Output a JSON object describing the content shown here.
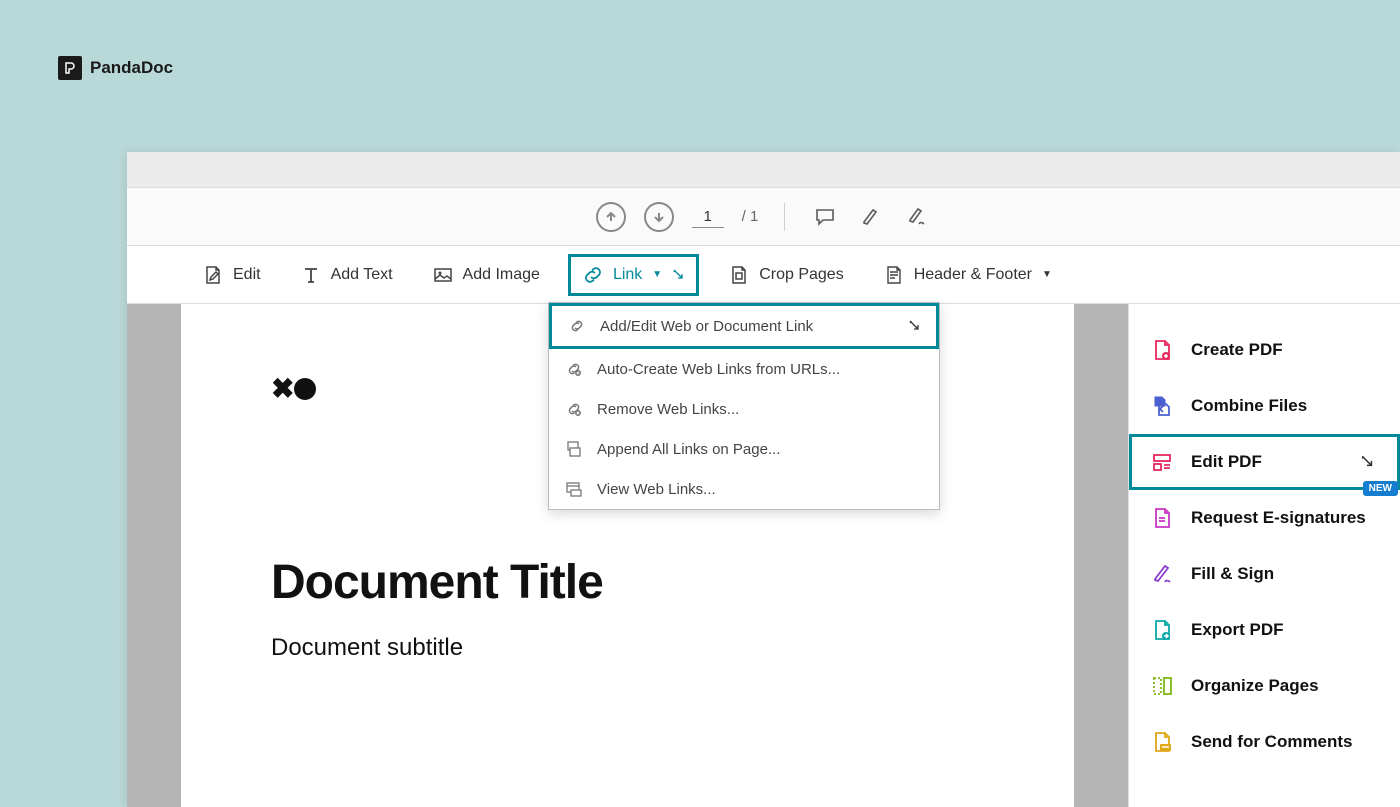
{
  "brand": {
    "name": "PandaDoc"
  },
  "pagebar": {
    "current": "1",
    "total": "/ 1"
  },
  "toolbar": {
    "edit": "Edit",
    "addText": "Add Text",
    "addImage": "Add Image",
    "link": "Link",
    "cropPages": "Crop Pages",
    "headerFooter": "Header & Footer"
  },
  "linkMenu": {
    "items": [
      "Add/Edit Web or Document Link",
      "Auto-Create Web Links from URLs...",
      "Remove Web Links...",
      "Append All Links on Page...",
      "View Web Links..."
    ]
  },
  "document": {
    "title": "Document Title",
    "subtitle": "Document subtitle"
  },
  "sidebar": {
    "createPdf": "Create PDF",
    "combineFiles": "Combine Files",
    "editPdf": "Edit PDF",
    "requestSig": "Request E-signatures",
    "fillSign": "Fill & Sign",
    "exportPdf": "Export PDF",
    "organizePages": "Organize Pages",
    "sendComments": "Send for Comments",
    "badge": "NEW"
  }
}
